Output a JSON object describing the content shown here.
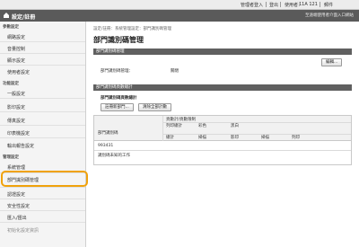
{
  "topbar": {
    "admin_link": "管理者登入",
    "logout_link": "登出",
    "username_label": "使用者：",
    "username": "11A 121",
    "mail_link": "郵件"
  },
  "titlebar": {
    "title": "設定/註冊",
    "right_text": "至遠端使用者介面入口網站"
  },
  "sidebar": {
    "sections": [
      {
        "heading": "參數設定",
        "items": [
          "網路設定",
          "音量控制",
          "顯示設定",
          "使用者設定"
        ]
      },
      {
        "heading": "功能設定",
        "items": [
          "一般設定",
          "影印設定",
          "傳真設定",
          "印表機設定",
          "輸出報告設定"
        ]
      },
      {
        "heading": "管理設定",
        "items": [
          "系統管理",
          "部門識別碼管理",
          "認證設定",
          "安全性設定",
          "匯入/匯出",
          "初始化設定資訊"
        ]
      }
    ]
  },
  "main": {
    "breadcrumb": "設定/註冊：系統管理設定：部門識別碼管理",
    "page_title": "部門識別碼管理",
    "section1_title": "部門識別碼管理",
    "dept_mgmt_label": "部門識別碼管理：",
    "dept_mgmt_value": "關閉",
    "edit_button": "編輯...",
    "section2_title": "部門識別碼頁數總計",
    "subsection_title": "部門識別碼頁數總計",
    "register_button": "註冊新部門...",
    "clear_button": "清除全部計數",
    "table": {
      "col_dept": "部門識別碼",
      "col_total": "頁數計/頁數限制",
      "col_copy_total": "列印總計",
      "col_color": "彩色",
      "col_bw": "黑白",
      "col_total_sub": "總計",
      "col_scan": "掃描",
      "col_color2": "影印",
      "col_scan2": "掃描",
      "col_print": "列印",
      "rows": [
        {
          "dept": "993431",
          "total": "",
          "scan": "",
          "copy": "",
          "print": ""
        },
        {
          "dept": "識別碼未知的工作",
          "total": "",
          "scan": "",
          "copy": "",
          "print": ""
        }
      ]
    }
  }
}
